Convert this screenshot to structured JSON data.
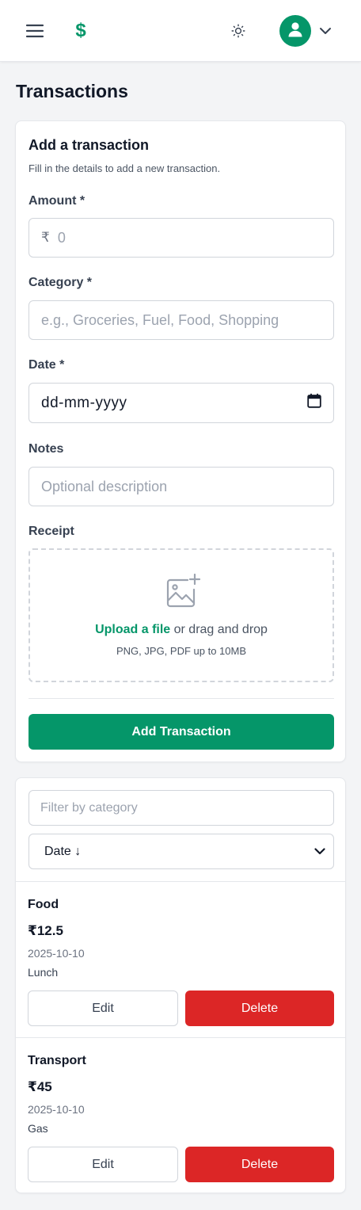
{
  "header": {
    "menu_icon": "hamburger-menu-icon",
    "logo_symbol": "$",
    "theme_icon": "sun-icon",
    "avatar_icon": "user-icon",
    "chevron_icon": "chevron-down-icon",
    "accent_color": "#059669"
  },
  "page": {
    "title": "Transactions"
  },
  "form": {
    "title": "Add a transaction",
    "subtitle": "Fill in the details to add a new transaction.",
    "amount": {
      "label": "Amount *",
      "currency": "₹",
      "placeholder": "0"
    },
    "category": {
      "label": "Category *",
      "placeholder": "e.g., Groceries, Fuel, Food, Shopping"
    },
    "date": {
      "label": "Date *",
      "placeholder": "dd-mm-yyyy",
      "icon": "calendar-icon"
    },
    "notes": {
      "label": "Notes",
      "placeholder": "Optional description"
    },
    "receipt": {
      "label": "Receipt",
      "upload_link": "Upload a file",
      "drag_text": " or drag and drop",
      "hint": "PNG, JPG, PDF up to 10MB",
      "icon": "image-add-icon"
    },
    "submit_label": "Add Transaction"
  },
  "list": {
    "filter_placeholder": "Filter by category",
    "sort_selected": "Date ↓",
    "items": [
      {
        "category": "Food",
        "amount": "₹12.5",
        "date": "2025-10-10",
        "note": "Lunch",
        "edit_label": "Edit",
        "delete_label": "Delete"
      },
      {
        "category": "Transport",
        "amount": "₹45",
        "date": "2025-10-10",
        "note": "Gas",
        "edit_label": "Edit",
        "delete_label": "Delete"
      }
    ]
  },
  "colors": {
    "primary": "#059669",
    "danger": "#dc2626",
    "background": "#f3f4f6"
  }
}
